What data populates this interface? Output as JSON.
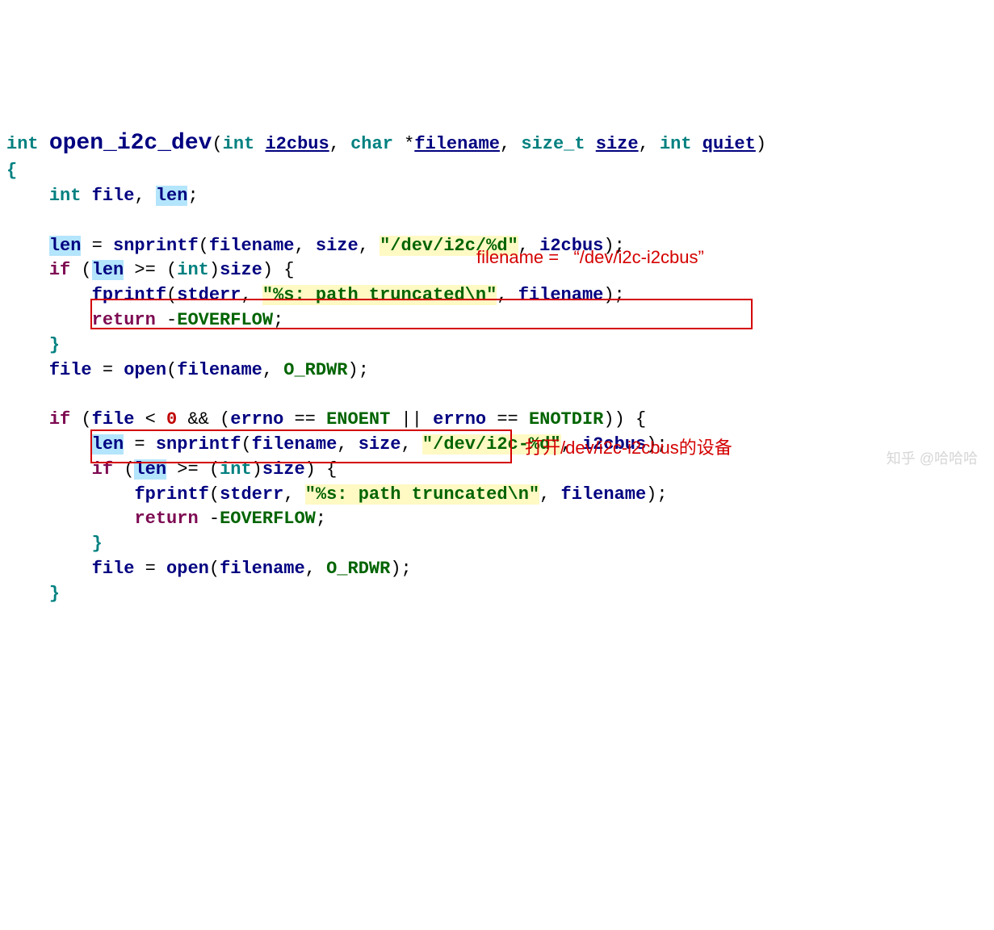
{
  "sig": {
    "ret": "int",
    "name": "open_i2c_dev",
    "lparen": "(",
    "p1t": "int",
    "p1": "i2cbus",
    "c1": ", ",
    "p2t": "char",
    "star": " *",
    "p2": "filename",
    "c2": ", ",
    "p3t": "size_t",
    "p3": "size",
    "c3": ", ",
    "p4t": "int",
    "p4": "quiet",
    "rparen": ")"
  },
  "b": {
    "open": "{",
    "close": "}"
  },
  "d": {
    "int": "int",
    "file": "file",
    "comma": ", ",
    "len": "len",
    "semi": ";"
  },
  "l1": {
    "len": "len",
    "eq": " = ",
    "fn": "snprintf",
    "l": "(",
    "a1": "filename",
    "c1": ", ",
    "a2": "size",
    "c2": ", ",
    "s": "\"/dev/i2c/%d\"",
    "c3": ", ",
    "a3": "i2cbus",
    "r": ");"
  },
  "if1": {
    "kw": "if",
    "l": " (",
    "len": "len",
    "op": " >= (",
    "cast": "int",
    "r1": ")",
    "size": "size",
    "r2": ") {"
  },
  "fp1": {
    "fn": "fprintf",
    "l": "(",
    "a1": "stderr",
    "c1": ", ",
    "s": "\"%s: path truncated\\n\"",
    "c2": ", ",
    "a2": "filename",
    "r": ");"
  },
  "ret1": {
    "kw": "return",
    "neg": " -",
    "m": "EOVERFLOW",
    "s": ";"
  },
  "asgn1": {
    "lhs": "file",
    "eq": " = ",
    "fn": "open",
    "l": "(",
    "a1": "filename",
    "c": ", ",
    "a2": "O_RDWR",
    "r": ");"
  },
  "if2": {
    "kw": "if",
    "l": " (",
    "file": "file",
    "lt": " < ",
    "zero": "0",
    "and": " && (",
    "e1": "errno",
    "eq1": " == ",
    "m1": "ENOENT",
    "or": " || ",
    "e2": "errno",
    "eq2": " == ",
    "m2": "ENOTDIR",
    "r": ")) {"
  },
  "l2": {
    "len": "len",
    "eq": " = ",
    "fn": "snprintf",
    "l": "(",
    "a1": "filename",
    "c1": ", ",
    "a2": "size",
    "c2": ", ",
    "s": "\"/dev/i2c-%d\"",
    "c3": ", ",
    "a3": "i2cbus",
    "r": ");"
  },
  "if3": {
    "kw": "if",
    "l": " (",
    "len": "len",
    "op": " >= (",
    "cast": "int",
    "r1": ")",
    "size": "size",
    "r2": ") {"
  },
  "fp2": {
    "fn": "fprintf",
    "l": "(",
    "a1": "stderr",
    "c1": ", ",
    "s": "\"%s: path truncated\\n\"",
    "c2": ", ",
    "a2": "filename",
    "r": ");"
  },
  "ret2": {
    "kw": "return",
    "neg": " -",
    "m": "EOVERFLOW",
    "s": ";"
  },
  "asgn2": {
    "lhs": "file",
    "eq": " = ",
    "fn": "open",
    "l": "(",
    "a1": "filename",
    "c": ", ",
    "a2": "O_RDWR",
    "r": ");"
  },
  "notes": {
    "n1": "filename =   “/dev/i2c-i2cbus”",
    "n2": "打开/dev/i2c-i2cbus的设备"
  },
  "watermark": "知乎 @哈哈哈"
}
